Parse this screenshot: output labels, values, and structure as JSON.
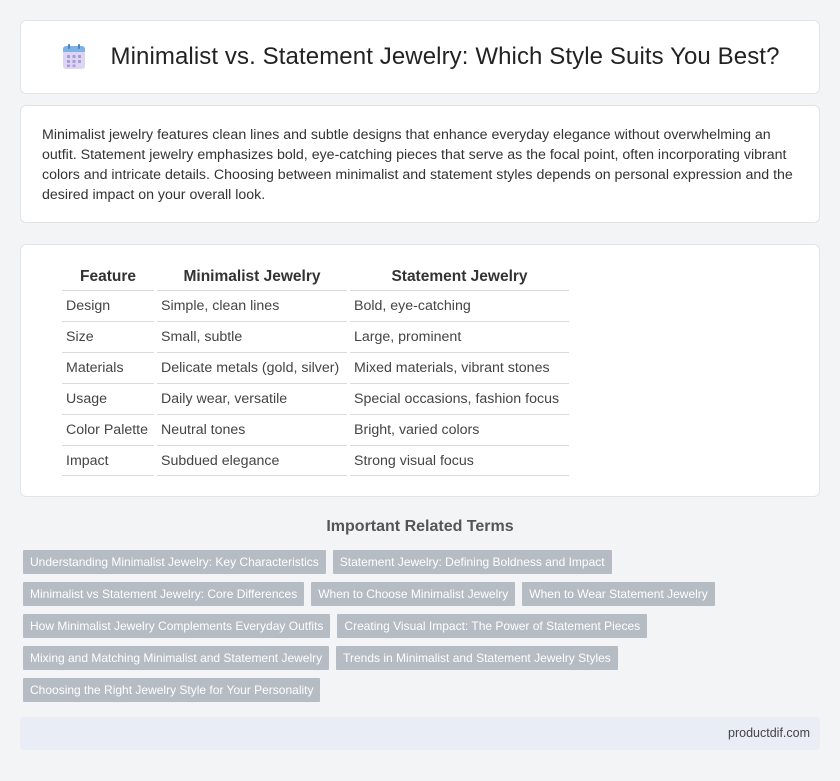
{
  "header": {
    "title": "Minimalist vs. Statement Jewelry: Which Style Suits You Best?",
    "icon": "document-grid-icon"
  },
  "intro": {
    "text": "Minimalist jewelry features clean lines and subtle designs that enhance everyday elegance without overwhelming an outfit. Statement jewelry emphasizes bold, eye-catching pieces that serve as the focal point, often incorporating vibrant colors and intricate details. Choosing between minimalist and statement styles depends on personal expression and the desired impact on your overall look."
  },
  "table": {
    "headers": [
      "Feature",
      "Minimalist Jewelry",
      "Statement Jewelry"
    ],
    "rows": [
      [
        "Design",
        "Simple, clean lines",
        "Bold, eye-catching"
      ],
      [
        "Size",
        "Small, subtle",
        "Large, prominent"
      ],
      [
        "Materials",
        "Delicate metals (gold, silver)",
        "Mixed materials, vibrant stones"
      ],
      [
        "Usage",
        "Daily wear, versatile",
        "Special occasions, fashion focus"
      ],
      [
        "Color Palette",
        "Neutral tones",
        "Bright, varied colors"
      ],
      [
        "Impact",
        "Subdued elegance",
        "Strong visual focus"
      ]
    ]
  },
  "related": {
    "title": "Important Related Terms",
    "tags": [
      "Understanding Minimalist Jewelry: Key Characteristics",
      "Statement Jewelry: Defining Boldness and Impact",
      "Minimalist vs Statement Jewelry: Core Differences",
      "When to Choose Minimalist Jewelry",
      "When to Wear Statement Jewelry",
      "How Minimalist Jewelry Complements Everyday Outfits",
      "Creating Visual Impact: The Power of Statement Pieces",
      "Mixing and Matching Minimalist and Statement Jewelry",
      "Trends in Minimalist and Statement Jewelry Styles",
      "Choosing the Right Jewelry Style for Your Personality"
    ]
  },
  "footer": {
    "site": "productdif.com"
  },
  "colors": {
    "background": "#f3f4f6",
    "tag": "#b6bcc4",
    "footer": "#e9edf6"
  }
}
